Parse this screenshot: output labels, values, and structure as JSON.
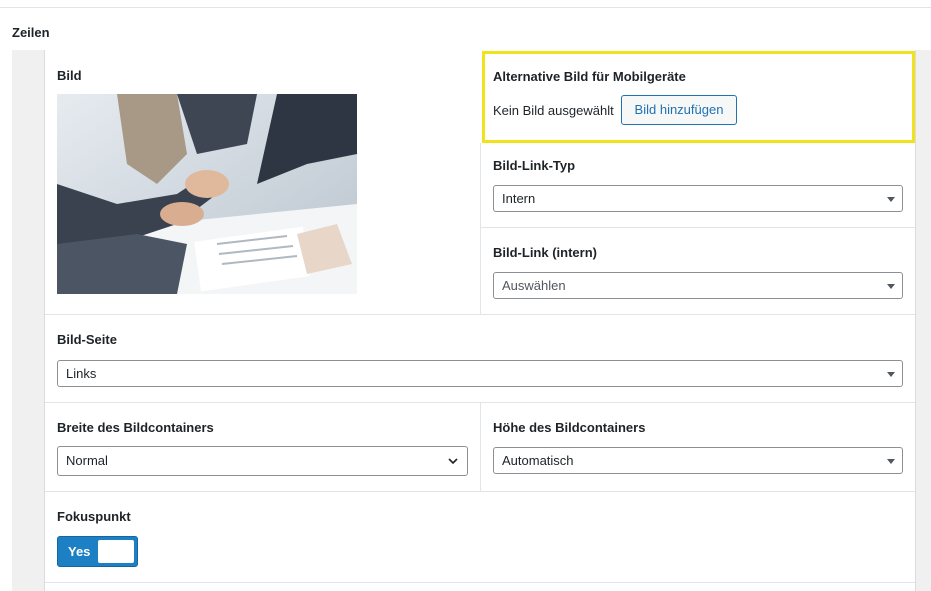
{
  "section": {
    "title": "Zeilen"
  },
  "fields": {
    "image": {
      "label": "Bild"
    },
    "mobile_image": {
      "label": "Alternative Bild für Mobilgeräte",
      "status": "Kein Bild ausgewählt",
      "button": "Bild hinzufügen"
    },
    "link_type": {
      "label": "Bild-Link-Typ",
      "value": "Intern"
    },
    "link_internal": {
      "label": "Bild-Link (intern)",
      "placeholder": "Auswählen"
    },
    "image_side": {
      "label": "Bild-Seite",
      "value": "Links"
    },
    "container_width": {
      "label": "Breite des Bildcontainers",
      "value": "Normal"
    },
    "container_height": {
      "label": "Höhe des Bildcontainers",
      "value": "Automatisch"
    },
    "focus_point": {
      "label": "Fokuspunkt",
      "toggle_label": "Yes",
      "enabled": true
    }
  },
  "colors": {
    "accent": "#2271b1",
    "toggle": "#1e80c4",
    "highlight": "#f0e31c"
  }
}
